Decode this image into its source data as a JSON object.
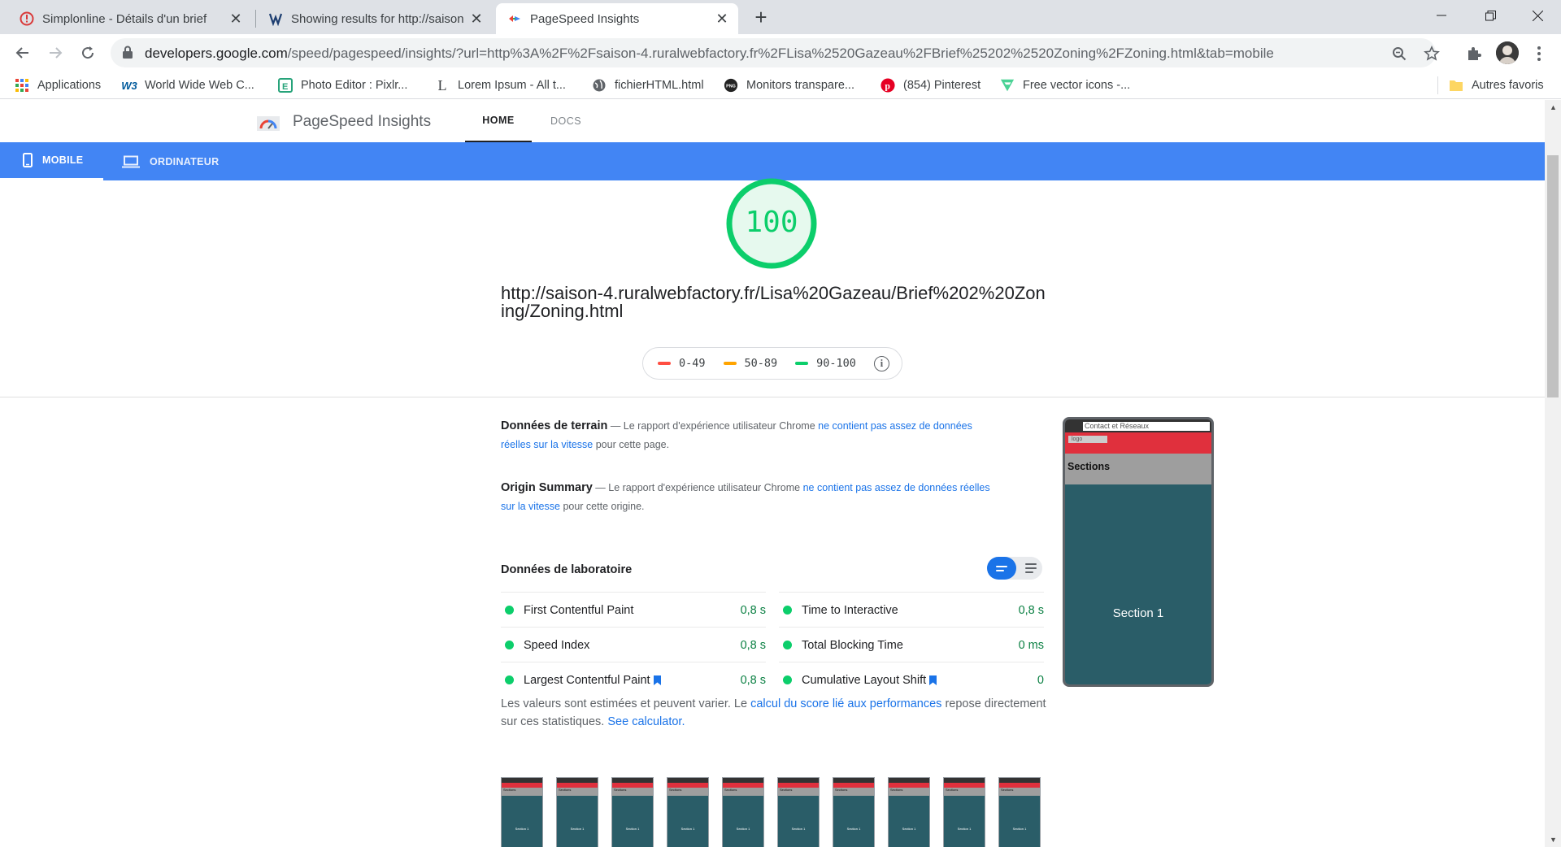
{
  "browser": {
    "tabs": [
      {
        "title": "Simplonline - Détails d'un brief",
        "icon": "simplonline-icon"
      },
      {
        "title": "Showing results for http://saison",
        "icon": "w3c-validator-icon"
      },
      {
        "title": "PageSpeed Insights",
        "icon": "pagespeed-icon"
      }
    ],
    "url_host": "developers.google.com",
    "url_path": "/speed/pagespeed/insights/?url=http%3A%2F%2Fsaison-4.ruralwebfactory.fr%2FLisa%2520Gazeau%2FBrief%25202%2520Zoning%2FZoning.html&tab=mobile",
    "bookmarks": [
      {
        "label": "Applications",
        "icon": "apps-grid-icon"
      },
      {
        "label": "World Wide Web C...",
        "icon": "w3c-icon"
      },
      {
        "label": "Photo Editor : Pixlr...",
        "icon": "pixlr-icon"
      },
      {
        "label": "Lorem Ipsum - All t...",
        "icon": "lorem-l-icon"
      },
      {
        "label": "fichierHTML.html",
        "icon": "globe-icon"
      },
      {
        "label": "Monitors transpare...",
        "icon": "pngtree-icon"
      },
      {
        "label": "(854) Pinterest",
        "icon": "pinterest-icon"
      },
      {
        "label": "Free vector icons -...",
        "icon": "flaticon-icon"
      }
    ],
    "other_bookmarks": "Autres favoris"
  },
  "psi": {
    "title": "PageSpeed Insights",
    "nav": {
      "home": "HOME",
      "docs": "DOCS"
    },
    "device_tabs": {
      "mobile": "MOBILE",
      "desktop": "ORDINATEUR"
    },
    "score": "100",
    "score_fraction": 1.0,
    "tested_url": "http://saison-4.ruralwebfactory.fr/Lisa%20Gazeau/Brief%202%20Zoning/Zoning.html",
    "legend": [
      {
        "label": "0-49",
        "color": "#ff4e42"
      },
      {
        "label": "50-89",
        "color": "#ffa400"
      },
      {
        "label": "90-100",
        "color": "#0cce6b"
      }
    ],
    "field_data": {
      "label": "Données de terrain",
      "dash": "— Le rapport d'expérience utilisateur Chrome",
      "link": "ne contient pas assez de données réelles sur la vitesse",
      "tail": "pour cette page."
    },
    "origin_summary": {
      "label": "Origin Summary",
      "dash": "— Le rapport d'expérience utilisateur Chrome",
      "link": "ne contient pas assez de données réelles sur la vitesse",
      "tail": "pour cette origine."
    },
    "lab_title": "Données de laboratoire",
    "metrics": [
      {
        "name": "First Contentful Paint",
        "value": "0,8 s"
      },
      {
        "name": "Time to Interactive",
        "value": "0,8 s"
      },
      {
        "name": "Speed Index",
        "value": "0,8 s"
      },
      {
        "name": "Total Blocking Time",
        "value": "0 ms"
      },
      {
        "name": "Largest Contentful Paint",
        "value": "0,8 s"
      },
      {
        "name": "Cumulative Layout Shift",
        "value": "0"
      }
    ],
    "note": {
      "p1": "Les valeurs sont estimées et peuvent varier. Le",
      "link1": "calcul du score lié aux performances",
      "p2": "repose directement sur ces statistiques.",
      "link2": "See calculator."
    },
    "screenshot": {
      "contact": "Contact et Réseaux",
      "logo": "logo",
      "sections": "Sections",
      "section1": "Section 1"
    },
    "film_frame_text": {
      "sections": "Sections",
      "section1": "Section 1"
    }
  },
  "colors": {
    "accent": "#4285f4",
    "pass": "#0cce6b",
    "link": "#1a73e8"
  }
}
